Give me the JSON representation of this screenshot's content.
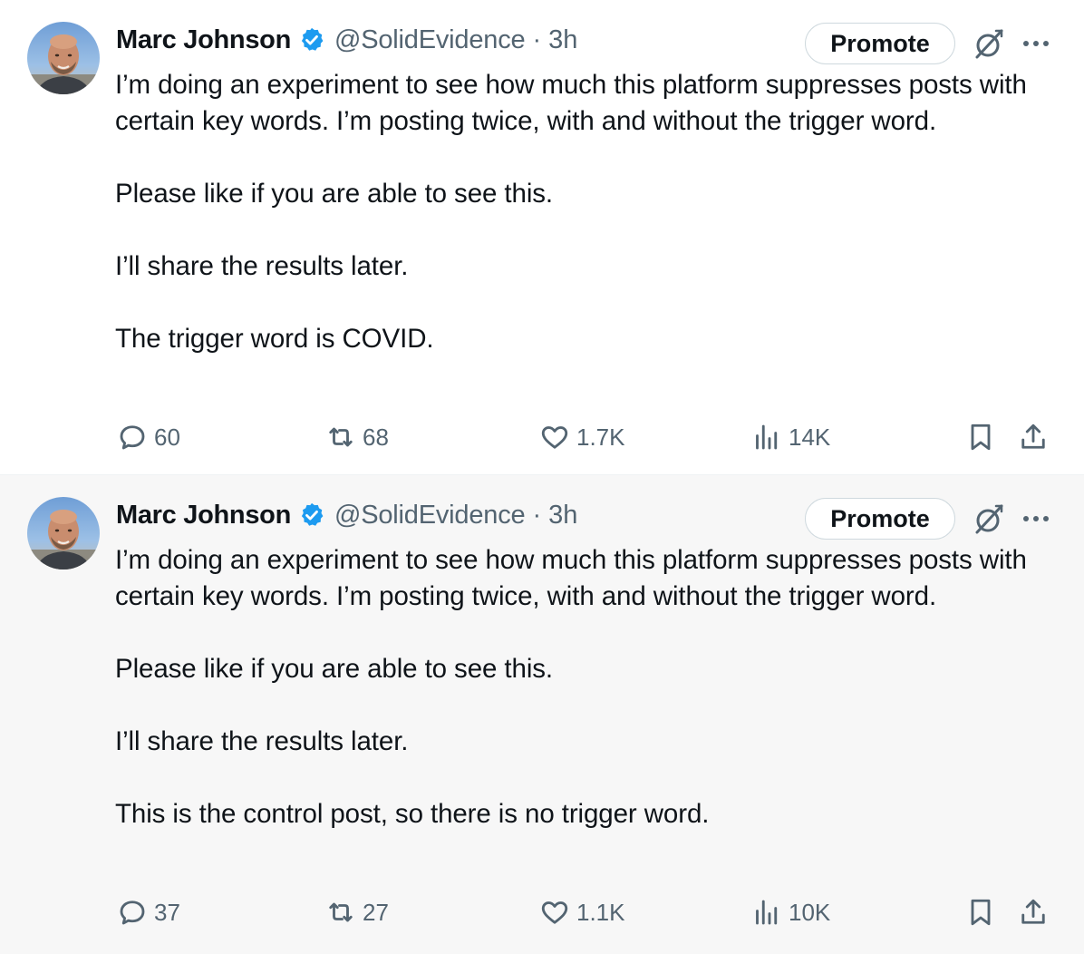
{
  "posts": [
    {
      "author": {
        "name": "Marc Johnson",
        "handle": "@SolidEvidence",
        "separator": "·",
        "time": "3h"
      },
      "promote_label": "Promote",
      "paragraphs": [
        "I’m doing an experiment to see how much this platform suppresses posts with certain key words.  I’m posting twice, with and without the trigger word.",
        "Please like if you are able to see this.",
        "I’ll share the results later.",
        "The trigger word is COVID."
      ],
      "stats": {
        "replies": "60",
        "reposts": "68",
        "likes": "1.7K",
        "views": "14K"
      }
    },
    {
      "author": {
        "name": "Marc Johnson",
        "handle": "@SolidEvidence",
        "separator": "·",
        "time": "3h"
      },
      "promote_label": "Promote",
      "paragraphs": [
        "I’m doing an experiment to see how much this platform suppresses posts with certain key words.  I’m posting twice, with and without the trigger word.",
        "Please like if you are able to see this.",
        "I’ll share the results later.",
        "This is the control post, so there is no trigger word."
      ],
      "stats": {
        "replies": "37",
        "reposts": "27",
        "likes": "1.1K",
        "views": "10K"
      }
    }
  ],
  "icons": {
    "verified": "verified-badge-icon",
    "grok": "grok-icon",
    "more": "more-icon",
    "reply": "reply-icon",
    "repost": "repost-icon",
    "like": "heart-icon",
    "views": "views-icon",
    "bookmark": "bookmark-icon",
    "share": "share-icon"
  },
  "colors": {
    "text_primary": "#0f1419",
    "text_secondary": "#536471",
    "verified_blue": "#1d9bf0",
    "border": "#cfd9de",
    "hover_background": "#f7f7f7"
  }
}
